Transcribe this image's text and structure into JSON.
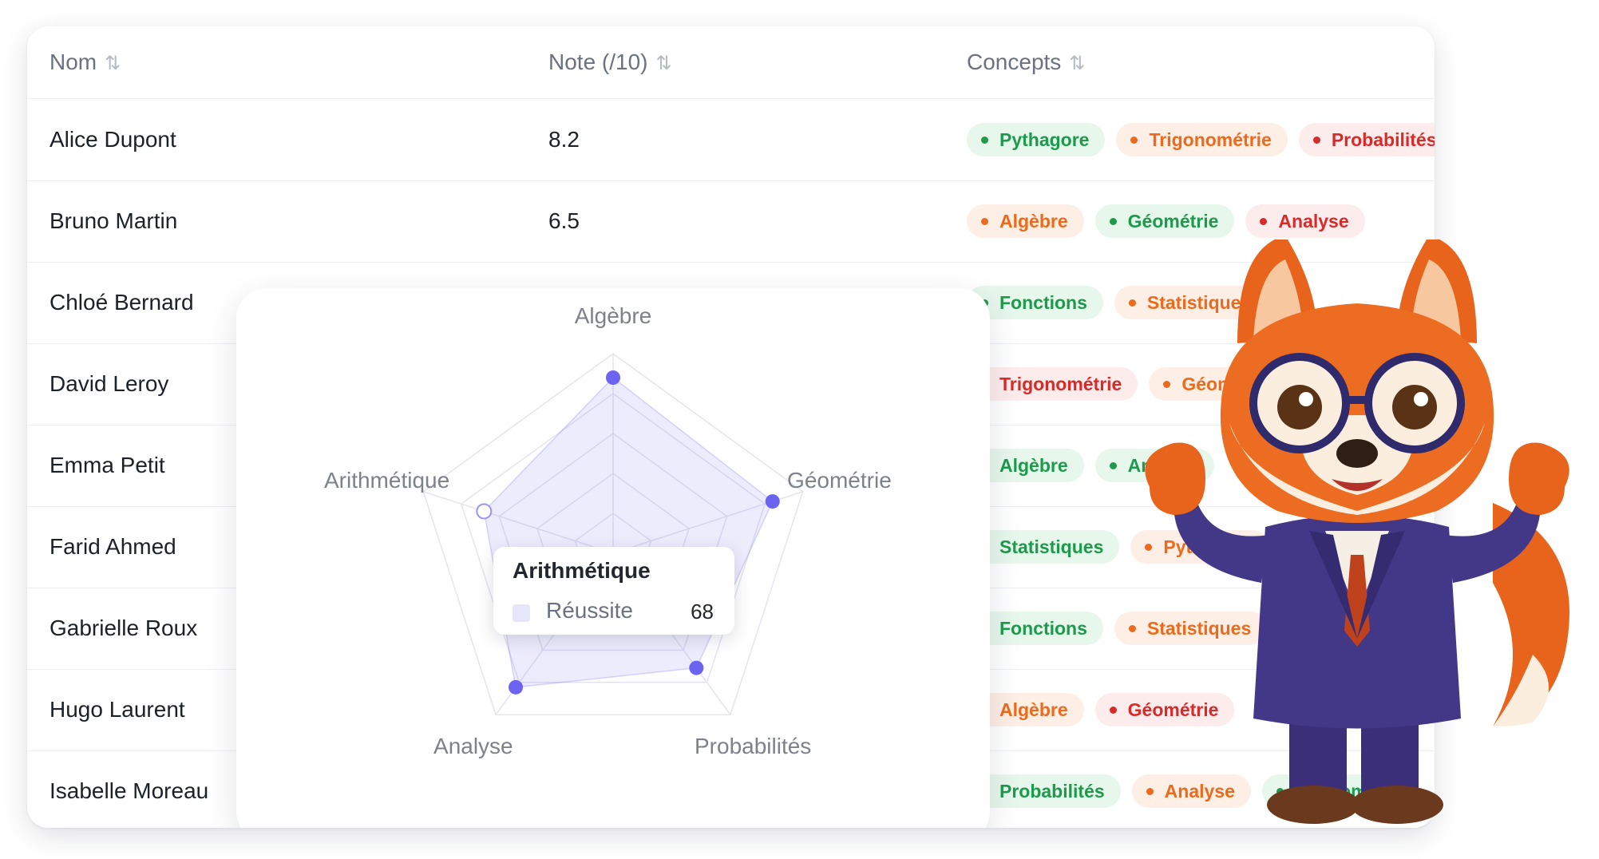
{
  "table": {
    "headers": {
      "name": "Nom",
      "note": "Note (/10)",
      "concepts": "Concepts",
      "sort_icon": "⇅"
    },
    "rows": [
      {
        "name": "Alice Dupont",
        "note": "8.2",
        "tags": [
          {
            "label": "Pythagore",
            "color": "green"
          },
          {
            "label": "Trigonométrie",
            "color": "orange"
          },
          {
            "label": "Probabilités",
            "color": "red"
          }
        ]
      },
      {
        "name": "Bruno Martin",
        "note": "6.5",
        "tags": [
          {
            "label": "Algèbre",
            "color": "orange"
          },
          {
            "label": "Géométrie",
            "color": "green"
          },
          {
            "label": "Analyse",
            "color": "red"
          }
        ]
      },
      {
        "name": "Chloé Bernard",
        "note": "",
        "tags": [
          {
            "label": "Fonctions",
            "color": "green"
          },
          {
            "label": "Statistiques",
            "color": "orange"
          }
        ]
      },
      {
        "name": "David Leroy",
        "note": "",
        "tags": [
          {
            "label": "Trigonométrie",
            "color": "red"
          },
          {
            "label": "Géométrie",
            "color": "orange"
          }
        ]
      },
      {
        "name": "Emma Petit",
        "note": "",
        "tags": [
          {
            "label": "Algèbre",
            "color": "green"
          },
          {
            "label": "Analyse",
            "color": "green"
          }
        ]
      },
      {
        "name": "Farid Ahmed",
        "note": "",
        "tags": [
          {
            "label": "Statistiques",
            "color": "green"
          },
          {
            "label": "Pythagore",
            "color": "orange"
          }
        ]
      },
      {
        "name": "Gabrielle Roux",
        "note": "",
        "tags": [
          {
            "label": "Fonctions",
            "color": "green"
          },
          {
            "label": "Statistiques",
            "color": "orange"
          }
        ]
      },
      {
        "name": "Hugo Laurent",
        "note": "",
        "tags": [
          {
            "label": "Algèbre",
            "color": "orange"
          },
          {
            "label": "Géométrie",
            "color": "red"
          }
        ]
      },
      {
        "name": "Isabelle Moreau",
        "note": "",
        "tags": [
          {
            "label": "Probabilités",
            "color": "green"
          },
          {
            "label": "Analyse",
            "color": "orange"
          },
          {
            "label": "Économie",
            "color": "green"
          }
        ]
      }
    ]
  },
  "chart_data": {
    "type": "radar",
    "axes": [
      "Algèbre",
      "Géométrie",
      "Probabilités",
      "Analyse",
      "Arithmétique"
    ],
    "series": [
      {
        "name": "Réussite",
        "values": [
          88,
          84,
          71,
          83,
          68
        ]
      }
    ],
    "range": [
      0,
      100
    ],
    "grid": true,
    "color": "#6c63f0"
  },
  "tooltip": {
    "title": "Arithmétique",
    "series": "Réussite",
    "value": "68"
  },
  "colors": {
    "accent": "#6c63f0",
    "green": "#1d9a4c",
    "orange": "#ec6a1c",
    "red": "#d92a2a"
  },
  "mascot": {
    "icon": "fox-mascot-icon"
  }
}
